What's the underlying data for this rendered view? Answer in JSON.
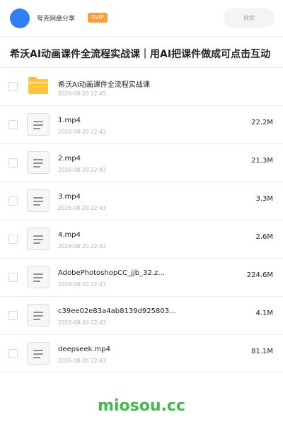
{
  "header": {
    "site_name": "夸克网盘分享",
    "badge": "SVIP",
    "search_placeholder": "搜索"
  },
  "title": "希沃AI动画课件全流程实战课｜用AI把课件做成可点击互动",
  "files": [
    {
      "type": "folder",
      "name": "希沃AI动画课件全流程实战课",
      "date": "2026-08-20 22:45",
      "size": ""
    },
    {
      "type": "file",
      "name": "1.mp4",
      "date": "2026-08-20 22:43",
      "size": "22.2M"
    },
    {
      "type": "file",
      "name": "2.mp4",
      "date": "2026-08-20 22:43",
      "size": "21.3M"
    },
    {
      "type": "file",
      "name": "3.mp4",
      "date": "2026-08-20 22:43",
      "size": "3.3M"
    },
    {
      "type": "file",
      "name": "4.mp4",
      "date": "2026-08-20 22:43",
      "size": "2.6M"
    },
    {
      "type": "file",
      "name": "AdobePhotoshopCC_jjb_32.z…",
      "date": "2026-08-20 22:43",
      "size": "224.6M"
    },
    {
      "type": "file",
      "name": "c39ee02e83a4ab8139d925803…",
      "date": "2026-08-20 22:43",
      "size": "4.1M"
    },
    {
      "type": "file",
      "name": "deepseek.mp4",
      "date": "2026-08-20 22:43",
      "size": "81.1M"
    }
  ],
  "footer": {
    "watermark": "miosou.cc"
  },
  "colors": {
    "accent": "#2f80f6",
    "svip": "#f7a03a",
    "watermark": "#3fba4f"
  }
}
